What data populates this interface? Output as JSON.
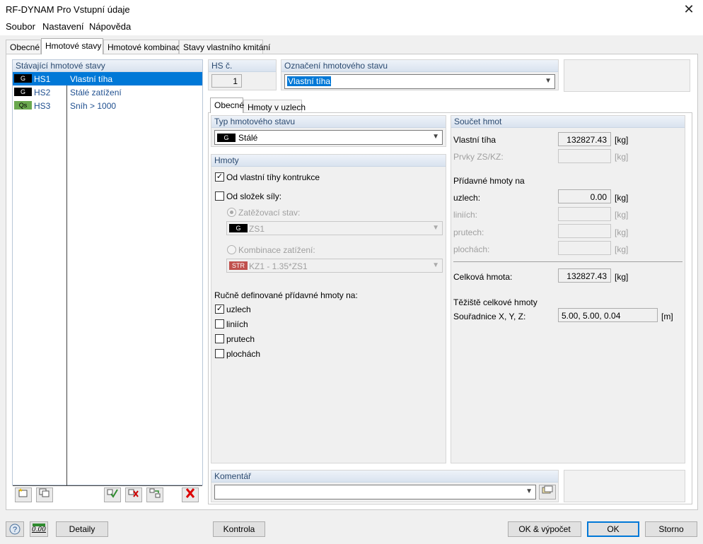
{
  "window": {
    "title": "RF-DYNAM Pro Vstupní údaje",
    "close_glyph": "✕"
  },
  "menu": {
    "items": [
      "Soubor",
      "Nastavení",
      "Nápověda"
    ]
  },
  "main_tabs": [
    "Obecné",
    "Hmotové stavy",
    "Hmotové kombinace",
    "Stavy vlastního kmitání"
  ],
  "mass_list": {
    "header": "Stávající hmotové stavy",
    "rows": [
      {
        "badge": "G",
        "id": "HS1",
        "name": "Vlastní tíha",
        "badge_color": "#000000"
      },
      {
        "badge": "G",
        "id": "HS2",
        "name": "Stálé zatížení",
        "badge_color": "#000000"
      },
      {
        "badge": "Qs",
        "id": "HS3",
        "name": "Sníh > 1000",
        "badge_color": "#6aa84f"
      }
    ],
    "toolbar_icons": [
      "new-case-icon",
      "copy-case-icon",
      "check-all-icon",
      "uncheck-all-icon",
      "renumber-icon",
      "delete-icon"
    ]
  },
  "hs_no": {
    "label": "HS č.",
    "value": "1"
  },
  "designation": {
    "label": "Označení hmotového stavu",
    "value": "Vlastní tíha"
  },
  "sub_tabs": [
    "Obecné",
    "Hmoty v uzlech"
  ],
  "type": {
    "header": "Typ hmotového stavu",
    "badge": "G",
    "value": "Stálé"
  },
  "masses": {
    "header": "Hmoty",
    "self_weight": "Od vlastní tíhy kontrukce",
    "force_components": "Od složek síly:",
    "load_case_label": "Zatěžovací stav:",
    "load_case_badge": "G",
    "load_case_value": "ZS1",
    "combo_label": "Kombinace zatížení:",
    "combo_badge": "STR",
    "combo_value": "KZ1 - 1.35*ZS1",
    "manual_label": "Ručně definované přídavné hmoty na:",
    "manual_items": [
      "uzlech",
      "liniích",
      "prutech",
      "plochách"
    ]
  },
  "sum": {
    "header": "Součet hmot",
    "self_weight_label": "Vlastní tíha",
    "self_weight_value": "132827.43",
    "elements_label": "Prvky ZS/KZ:",
    "additional_label": "Přídavné hmoty na",
    "nodes_label": "uzlech:",
    "nodes_value": "0.00",
    "lines_label": "liniích:",
    "members_label": "prutech:",
    "surfaces_label": "plochách:",
    "total_label": "Celková hmota:",
    "total_value": "132827.43",
    "cog_label": "Těžiště celkové hmoty",
    "coords_label": "Souřadnice X, Y, Z:",
    "coords_value": "5.00, 5.00, 0.04",
    "unit_kg": "[kg]",
    "unit_m": "[m]"
  },
  "comment": {
    "header": "Komentář",
    "value": ""
  },
  "bottom": {
    "details": "Detaily",
    "check": "Kontrola",
    "ok_calc": "OK & výpočet",
    "ok": "OK",
    "cancel": "Storno",
    "units_icon_text": "0.00"
  },
  "colors": {
    "selection": "#0078d7",
    "header_text": "#2b4a70",
    "str_badge": "#c0504d"
  }
}
